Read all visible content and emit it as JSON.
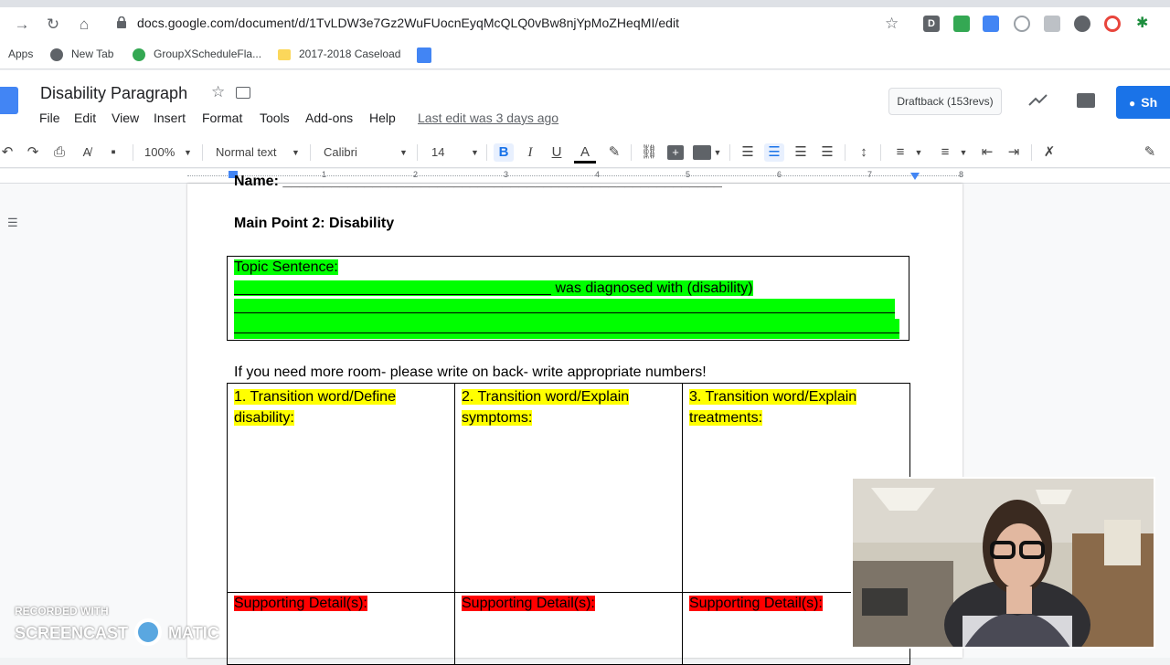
{
  "browser": {
    "url": "docs.google.com/document/d/1TvLDW3e7Gz2WuFUocnEyqMcQLQ0vBw8njYpMoZHeqMI/edit",
    "bookmarks": [
      "Apps",
      "New Tab",
      "GroupXScheduleFla...",
      "2017-2018 Caseload"
    ]
  },
  "docs": {
    "title": "Disability Paragraph",
    "menu": [
      "File",
      "Edit",
      "View",
      "Insert",
      "Format",
      "Tools",
      "Add-ons",
      "Help"
    ],
    "last_edit": "Last edit was 3 days ago",
    "draftback": "Draftback (153revs)",
    "share_label": "Sh"
  },
  "toolbar": {
    "zoom": "100%",
    "style": "Normal text",
    "font": "Calibri",
    "size": "14"
  },
  "ruler": [
    "1",
    "2",
    "3",
    "4",
    "5",
    "6",
    "7",
    "8"
  ],
  "document": {
    "name_line": "Name: ______________________________________________________",
    "heading": "Main Point 2: Disability",
    "topic_label": "Topic Sentence:",
    "topic_line2_blank": "_______________________________________",
    "topic_line2_text": " was diagnosed with (disability)",
    "topic_line3": "__________________________________________________________________________________",
    "topic_line4": "__________________________________________________________________________________",
    "instruction": "If you need more room- please write on back- write appropriate numbers!",
    "columns": [
      {
        "line1": "1. Transition word/Define",
        "line2": "disability:"
      },
      {
        "line1": "2. Transition word/Explain",
        "line2": "symptoms:"
      },
      {
        "line1": "3. Transition word/Explain",
        "line2": "treatments:"
      }
    ],
    "supporting": [
      "Supporting Detail(s):",
      "Supporting Detail(s):",
      "Supporting Detail(s):"
    ]
  },
  "watermark": {
    "line1": "RECORDED WITH",
    "line2": "SCREENCAST",
    "line3": "MATIC"
  },
  "colors": {
    "highlight_green": "#00ff00",
    "highlight_yellow": "#ffff00",
    "highlight_red": "#ff0000",
    "accent": "#1a73e8"
  }
}
